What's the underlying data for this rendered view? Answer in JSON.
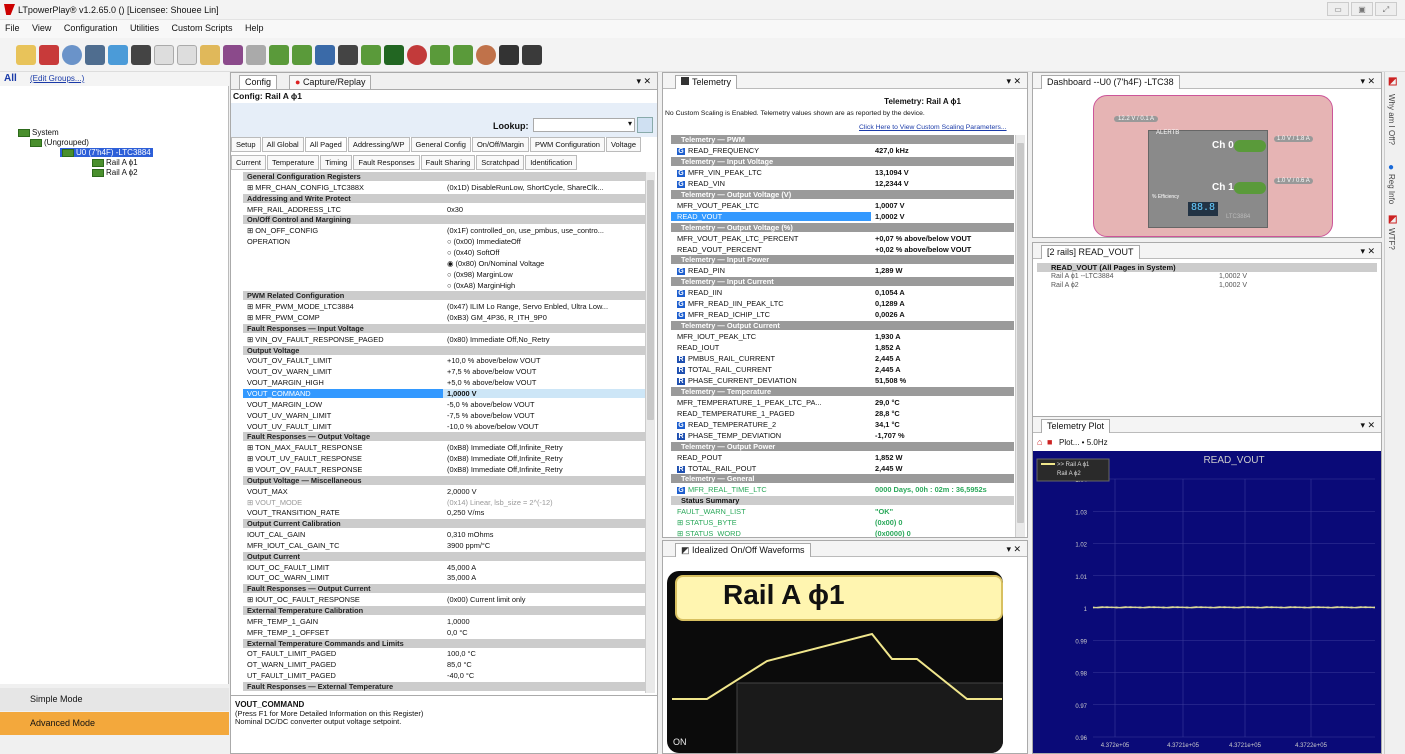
{
  "app": {
    "title": "LTpowerPlay® v1.2.65.0 () [Licensee: Shouee Lin]",
    "menu": [
      "File",
      "View",
      "Configuration",
      "Utilities",
      "Custom Scripts",
      "Help"
    ]
  },
  "left": {
    "all": "All",
    "edit_groups": "(Edit Groups...)",
    "tree": [
      "System",
      "(Ungrouped)",
      "U0 (7'h4F) -LTC3884",
      "Rail A ϕ1",
      "Rail A ϕ2"
    ],
    "simple": "Simple Mode",
    "advanced": "Advanced Mode"
  },
  "config": {
    "tab_config": "Config",
    "tab_capture": "Capture/Replay",
    "title": "Config: Rail A ϕ1",
    "lookup": "Lookup:",
    "tabs1": [
      "Setup",
      "All Global",
      "All Paged",
      "Addressing/WP",
      "General Config",
      "On/Off/Margin",
      "PWM Configuration",
      "Voltage"
    ],
    "tabs2": [
      "Current",
      "Temperature",
      "Timing",
      "Fault Responses",
      "Fault Sharing",
      "Scratchpad",
      "Identification"
    ],
    "rows": [
      [
        "General Configuration Registers",
        "",
        "sec"
      ],
      [
        "⊞ MFR_CHAN_CONFIG_LTC388X",
        "(0x1D) DisableRunLow, ShortCycle, ShareClk...",
        ""
      ],
      [
        "Addressing and Write Protect",
        "",
        "sec"
      ],
      [
        "MFR_RAIL_ADDRESS_LTC",
        "0x30",
        ""
      ],
      [
        "On/Off Control and Margining",
        "",
        "sec"
      ],
      [
        "⊞ ON_OFF_CONFIG",
        "(0x1F) controlled_on, use_pmbus, use_contro...",
        ""
      ],
      [
        "OPERATION",
        "○ (0x00) ImmediateOff",
        ""
      ],
      [
        "",
        "○ (0x40) SoftOff",
        ""
      ],
      [
        "",
        "◉ (0x80) On/Nominal Voltage",
        ""
      ],
      [
        "",
        "○ (0x98) MarginLow",
        ""
      ],
      [
        "",
        "○ (0xA8) MarginHigh",
        ""
      ],
      [
        "PWM Related Configuration",
        "",
        "sec"
      ],
      [
        "⊞ MFR_PWM_MODE_LTC3884",
        "(0x47) ILIM Lo Range, Servo Enbled, Ultra Low...",
        ""
      ],
      [
        "⊞ MFR_PWM_COMP",
        "(0xB3) GM_4P36, R_ITH_9P0",
        ""
      ],
      [
        "Fault Responses — Input Voltage",
        "",
        "sec"
      ],
      [
        "⊞ VIN_OV_FAULT_RESPONSE_PAGED",
        "(0x80) Immediate Off,No_Retry",
        ""
      ],
      [
        "Output Voltage",
        "",
        "sec"
      ],
      [
        "VOUT_OV_FAULT_LIMIT",
        "+10,0 % above/below VOUT",
        ""
      ],
      [
        "VOUT_OV_WARN_LIMIT",
        "+7,5 % above/below VOUT",
        ""
      ],
      [
        "VOUT_MARGIN_HIGH",
        "+5,0 % above/below VOUT",
        ""
      ],
      [
        "VOUT_COMMAND",
        "1,0000 V",
        "sel"
      ],
      [
        "VOUT_MARGIN_LOW",
        "-5,0 % above/below VOUT",
        ""
      ],
      [
        "VOUT_UV_WARN_LIMIT",
        "-7,5 % above/below VOUT",
        ""
      ],
      [
        "VOUT_UV_FAULT_LIMIT",
        "-10,0 % above/below VOUT",
        ""
      ],
      [
        "Fault Responses — Output Voltage",
        "",
        "sec"
      ],
      [
        "⊞ TON_MAX_FAULT_RESPONSE",
        "(0xB8) Immediate Off,Infinite_Retry",
        ""
      ],
      [
        "⊞ VOUT_UV_FAULT_RESPONSE",
        "(0xB8) Immediate Off,Infinite_Retry",
        ""
      ],
      [
        "⊞ VOUT_OV_FAULT_RESPONSE",
        "(0xB8) Immediate Off,Infinite_Retry",
        ""
      ],
      [
        "Output Voltage — Miscellaneous",
        "",
        "sec"
      ],
      [
        "VOUT_MAX",
        "2,0000 V",
        ""
      ],
      [
        "⊞ VOUT_MODE",
        "(0x14) Linear, lsb_size = 2^(-12)",
        "gray"
      ],
      [
        "VOUT_TRANSITION_RATE",
        "0,250 V/ms",
        ""
      ],
      [
        "Output Current Calibration",
        "",
        "sec"
      ],
      [
        "IOUT_CAL_GAIN",
        "0,310 mOhms",
        ""
      ],
      [
        "MFR_IOUT_CAL_GAIN_TC",
        "3900 ppm/°C",
        ""
      ],
      [
        "Output Current",
        "",
        "sec"
      ],
      [
        "IOUT_OC_FAULT_LIMIT",
        "45,000  A",
        ""
      ],
      [
        "IOUT_OC_WARN_LIMIT",
        "35,000  A",
        ""
      ],
      [
        "Fault Responses — Output Current",
        "",
        "sec"
      ],
      [
        "⊞ IOUT_OC_FAULT_RESPONSE",
        "(0x00) Current limit only",
        ""
      ],
      [
        "External Temperature Calibration",
        "",
        "sec"
      ],
      [
        "MFR_TEMP_1_GAIN",
        "1,0000",
        ""
      ],
      [
        "MFR_TEMP_1_OFFSET",
        "0,0 °C",
        ""
      ],
      [
        "External Temperature Commands and Limits",
        "",
        "sec"
      ],
      [
        "OT_FAULT_LIMIT_PAGED",
        "100,0 °C",
        ""
      ],
      [
        "OT_WARN_LIMIT_PAGED",
        "85,0 °C",
        ""
      ],
      [
        "UT_FAULT_LIMIT_PAGED",
        "-40,0 °C",
        ""
      ],
      [
        "Fault Responses — External Temperature",
        "",
        "sec"
      ]
    ],
    "help_title": "VOUT_COMMAND",
    "help_1": "(Press F1 for More Detailed Information on this Register)",
    "help_2": "Nominal DC/DC converter output voltage setpoint."
  },
  "telemetry": {
    "tab": "Telemetry",
    "title": "Telemetry: Rail A ϕ1",
    "note": "No Custom Scaling is Enabled.  Telemetry values shown are as reported by the device.",
    "link": "Click Here to View Custom Scaling Parameters...",
    "rows": [
      [
        "Telemetry — PWM",
        "",
        "sec",
        ""
      ],
      [
        "READ_FREQUENCY",
        "427,0 kHz",
        "",
        "G"
      ],
      [
        "Telemetry — Input Voltage",
        "",
        "sec",
        ""
      ],
      [
        "MFR_VIN_PEAK_LTC",
        "13,1094 V",
        "",
        "G"
      ],
      [
        "READ_VIN",
        "12,2344 V",
        "",
        "G"
      ],
      [
        "Telemetry — Output Voltage (V)",
        "",
        "sec",
        ""
      ],
      [
        "MFR_VOUT_PEAK_LTC",
        "1,0007 V",
        "",
        ""
      ],
      [
        "READ_VOUT",
        "1,0002 V",
        "sel",
        ""
      ],
      [
        "Telemetry — Output Voltage (%)",
        "",
        "sec",
        ""
      ],
      [
        "MFR_VOUT_PEAK_LTC_PERCENT",
        "+0,07 % above/below VOUT",
        "",
        ""
      ],
      [
        "READ_VOUT_PERCENT",
        "+0,02 % above/below VOUT",
        "",
        ""
      ],
      [
        "Telemetry — Input Power",
        "",
        "sec",
        ""
      ],
      [
        "READ_PIN",
        "1,289 W",
        "",
        "G"
      ],
      [
        "Telemetry — Input Current",
        "",
        "sec",
        ""
      ],
      [
        "READ_IIN",
        "0,1054 A",
        "",
        "G"
      ],
      [
        "MFR_READ_IIN_PEAK_LTC",
        "0,1289 A",
        "",
        "G"
      ],
      [
        "MFR_READ_ICHIP_LTC",
        "0,0026 A",
        "",
        "G"
      ],
      [
        "Telemetry — Output Current",
        "",
        "sec",
        ""
      ],
      [
        "MFR_IOUT_PEAK_LTC",
        "1,930  A",
        "",
        ""
      ],
      [
        "READ_IOUT",
        "1,852  A",
        "",
        ""
      ],
      [
        "PMBUS_RAIL_CURRENT",
        "2,445  A",
        "",
        "R"
      ],
      [
        "TOTAL_RAIL_CURRENT",
        "2,445  A",
        "",
        "R"
      ],
      [
        "PHASE_CURRENT_DEVIATION",
        "51,508 %",
        "",
        "R"
      ],
      [
        "Telemetry — Temperature",
        "",
        "sec",
        ""
      ],
      [
        "MFR_TEMPERATURE_1_PEAK_LTC_PA...",
        "29,0 °C",
        "",
        ""
      ],
      [
        "READ_TEMPERATURE_1_PAGED",
        "28,8 °C",
        "",
        ""
      ],
      [
        "READ_TEMPERATURE_2",
        "34,1 °C",
        "",
        "G"
      ],
      [
        "PHASE_TEMP_DEVIATION",
        "-1,707 %",
        "",
        "R"
      ],
      [
        "Telemetry — Output Power",
        "",
        "sec",
        ""
      ],
      [
        "READ_POUT",
        "1,852 W",
        "",
        ""
      ],
      [
        "TOTAL_RAIL_POUT",
        "2,445 W",
        "",
        "R"
      ],
      [
        "Telemetry — General",
        "",
        "sec",
        ""
      ],
      [
        "MFR_REAL_TIME_LTC",
        "0000 Days, 00h : 02m : 36,5952s",
        "green",
        "G"
      ],
      [
        "Status Summary",
        "",
        "sec2",
        ""
      ],
      [
        "FAULT_WARN_LIST",
        "\"OK\"",
        "green",
        ""
      ],
      [
        "⊞ STATUS_BYTE",
        "(0x00) 0",
        "green",
        ""
      ],
      [
        "⊞ STATUS_WORD",
        "(0x0000) 0",
        "green",
        ""
      ]
    ]
  },
  "waveform": {
    "tab": "Idealized On/Off Waveforms",
    "rail": "Rail A ϕ1",
    "on": "ON"
  },
  "dashboard": {
    "tab": "Dashboard --U0 (7'h4F) -LTC38",
    "vin": "12.2 V / 0.1 A",
    "ch0": "Ch 0",
    "ch1": "Ch 1",
    "ch0v": "1.0 V / 1.8 A",
    "ch1v": "1.0 V / 0.6 A",
    "alert": "ALERTB",
    "eff": "% Efficiency",
    "lcd": "88.8",
    "part": "LTC3884"
  },
  "readvout": {
    "tab": "[2 rails] READ_VOUT",
    "header": "READ_VOUT (All Pages in System)",
    "rows": [
      [
        "Rail A ϕ1 --LTC3884",
        "1,0002 V"
      ],
      [
        "Rail A ϕ2",
        "1,0002 V"
      ]
    ]
  },
  "plot": {
    "tab": "Telemetry Plot",
    "toolbar": "Plot...  • 5.0Hz",
    "title": "READ_VOUT",
    "legend": [
      ">> Rail A ϕ1",
      "Rail A ϕ2"
    ],
    "yticks": [
      "1.04",
      "1.03",
      "1.02",
      "1.01",
      "1",
      "0.99",
      "0.98",
      "0.97",
      "0.96"
    ],
    "xticks": [
      "4.372e+05",
      "4.3721e+05",
      "4.3721e+05",
      "4.3722e+05"
    ]
  },
  "sidebar": [
    "Why am I Off?",
    "Reg Info",
    "WTF?"
  ],
  "chart_data": {
    "type": "line",
    "title": "READ_VOUT",
    "x": [
      437200,
      437210,
      437220
    ],
    "series": [
      {
        "name": ">> Rail A ϕ1",
        "values": [
          1.0002,
          1.0002,
          1.0002
        ]
      },
      {
        "name": "Rail A ϕ2",
        "values": [
          1.0002,
          1.0002,
          1.0002
        ]
      }
    ],
    "ylim": [
      0.96,
      1.04
    ],
    "grid": true,
    "legend": "top-left"
  }
}
